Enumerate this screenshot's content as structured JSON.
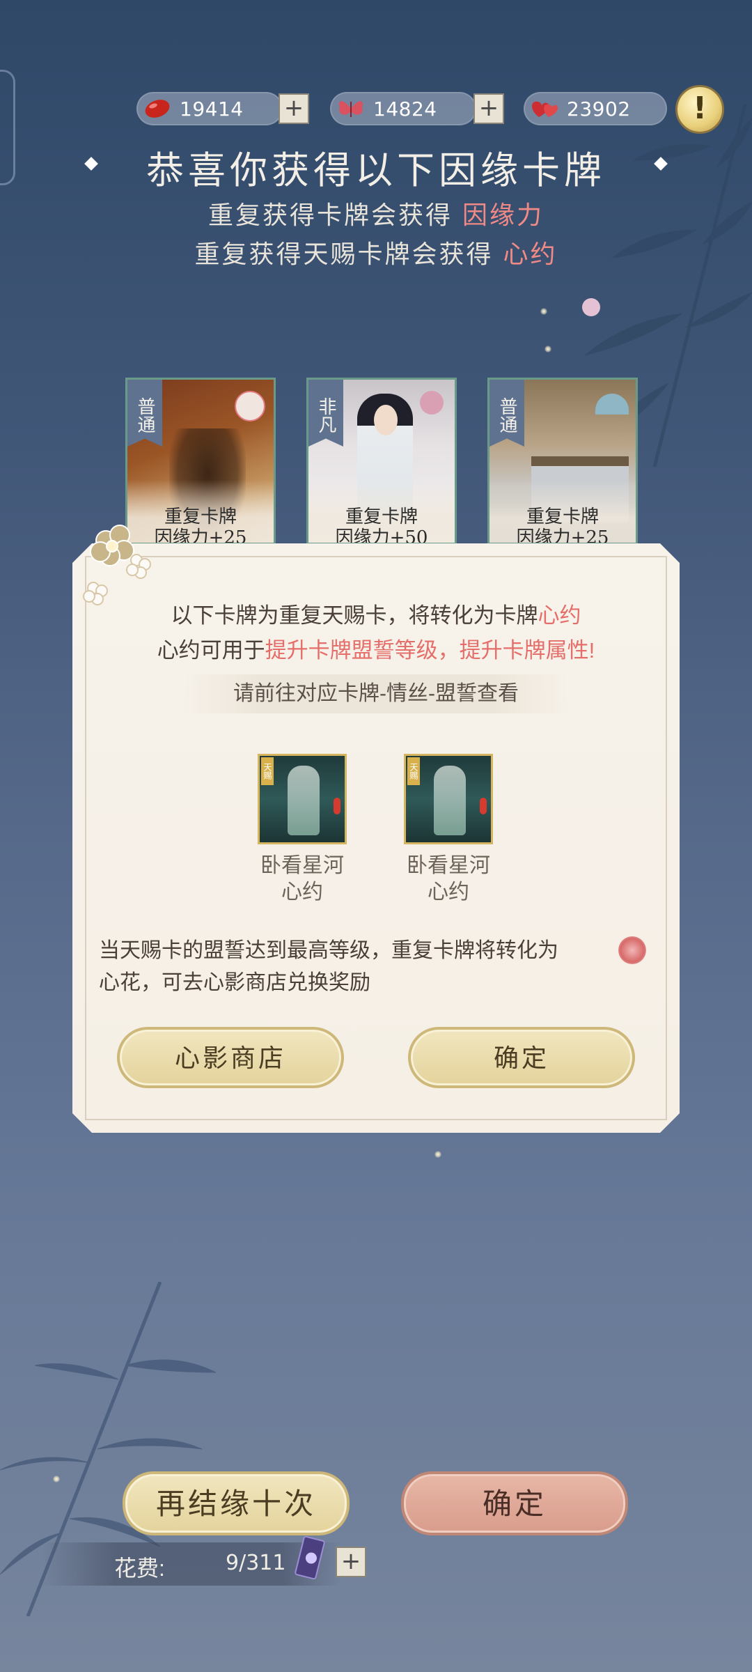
{
  "currencies": [
    {
      "icon": "red-bean-icon",
      "value": "19414"
    },
    {
      "icon": "pink-butterfly-icon",
      "value": "14824"
    },
    {
      "icon": "red-hearts-icon",
      "value": "23902"
    }
  ],
  "plus_label": "+",
  "alert_label": "!",
  "header": {
    "title": "恭喜你获得以下因缘卡牌",
    "line1_prefix": "重复获得卡牌会获得",
    "line1_highlight": "因缘力",
    "line2_prefix": "重复获得天赐卡牌会获得",
    "line2_highlight": "心约"
  },
  "cards": [
    {
      "rarity": "普通",
      "line1": "重复卡牌",
      "line2": "因缘力+25"
    },
    {
      "rarity": "非凡",
      "line1": "重复卡牌",
      "line2": "因缘力+50"
    },
    {
      "rarity": "普通",
      "line1": "重复卡牌",
      "line2": "因缘力+25"
    }
  ],
  "dialog": {
    "line1_prefix": "以下卡牌为重复天赐卡，将转化为卡牌",
    "line1_highlight": "心约",
    "line2_prefix": "心约可用于",
    "line2_highlight": "提升卡牌盟誓等级，提升卡牌属性!",
    "hint": "请前往对应卡牌-情丝-盟誓查看",
    "mini_tag": "天赐",
    "items": [
      {
        "name": "卧看星河",
        "sub": "心约"
      },
      {
        "name": "卧看星河",
        "sub": "心约"
      }
    ],
    "note_line1": "当天赐卡的盟誓达到最高等级，重复卡牌将转化为",
    "note_line2": "心花，可去心影商店兑换奖励",
    "shop_button": "心影商店",
    "confirm_button": "确定"
  },
  "bottom": {
    "again_button": "再结缘十次",
    "confirm_button": "确定",
    "cost_label": "花费:",
    "cost_value": "9/311"
  }
}
